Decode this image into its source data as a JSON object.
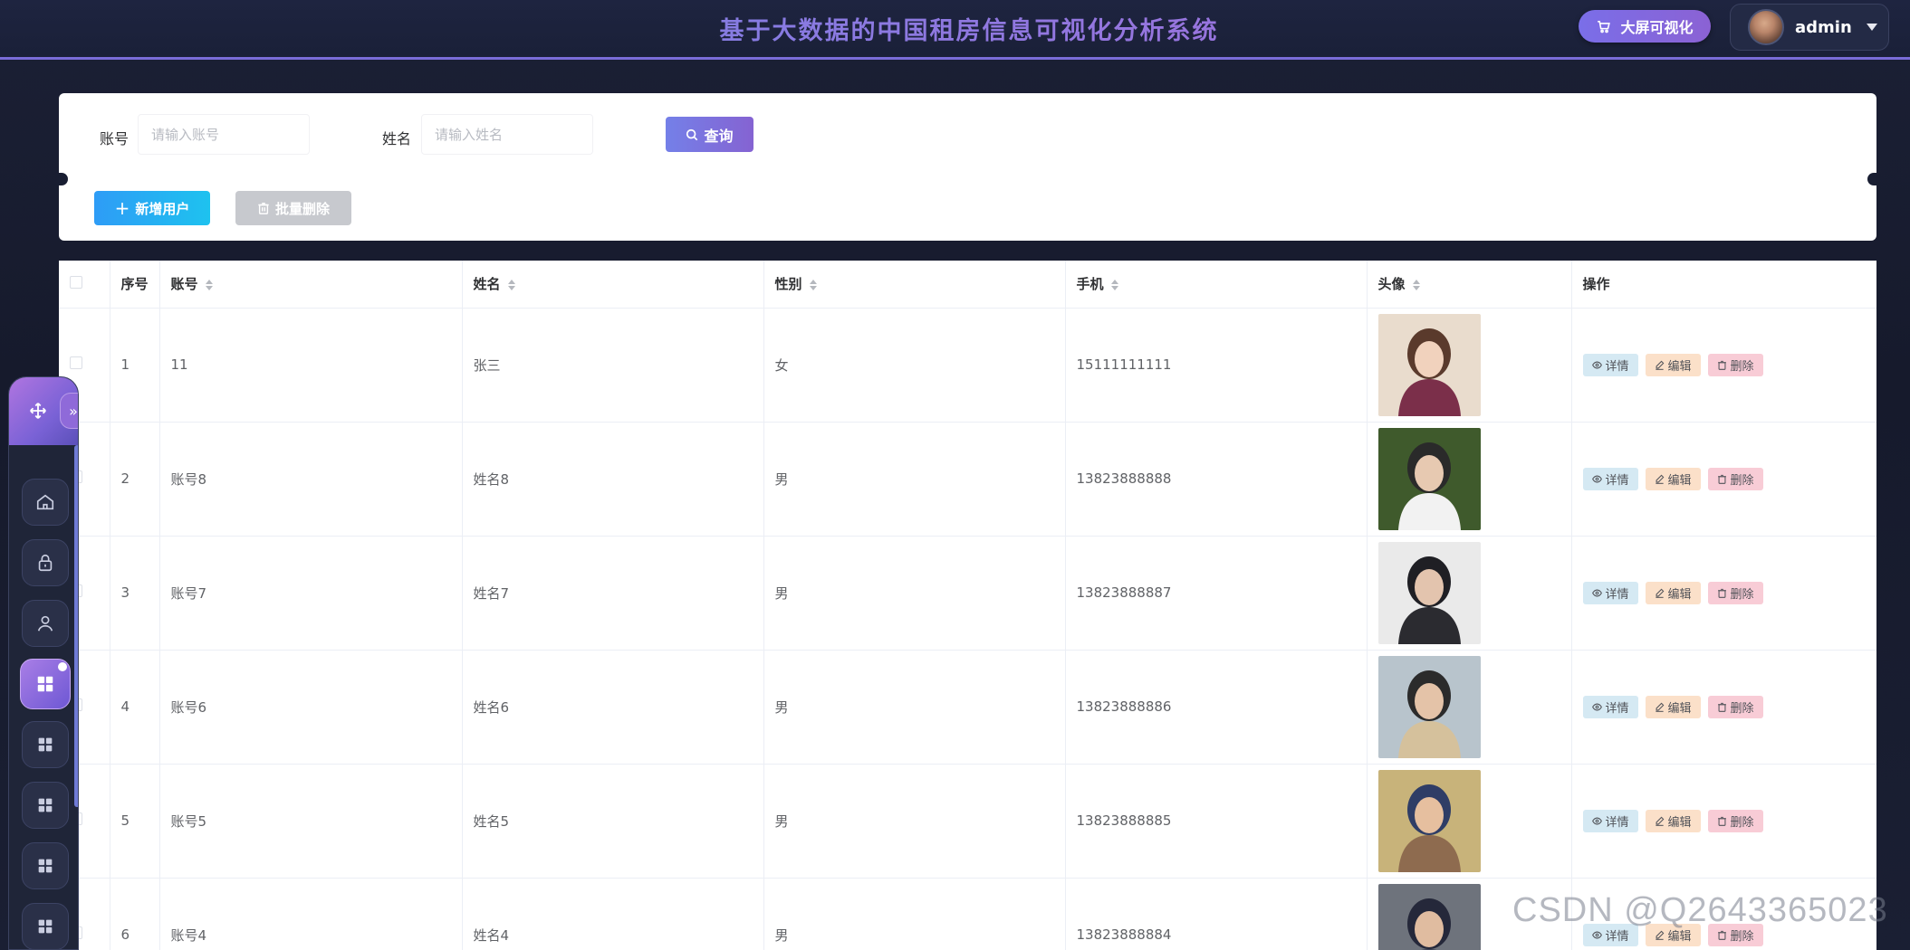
{
  "header": {
    "title": "基于大数据的中国租房信息可视化分析系统",
    "bigscreen_label": "大屏可视化",
    "user_name": "admin"
  },
  "search": {
    "account_label": "账号",
    "account_placeholder": "请输入账号",
    "name_label": "姓名",
    "name_placeholder": "请输入姓名",
    "query_label": "查询",
    "add_label": "新增用户",
    "batch_delete_label": "批量删除"
  },
  "table": {
    "columns": [
      "序号",
      "账号",
      "姓名",
      "性别",
      "手机",
      "头像",
      "操作"
    ],
    "op_labels": {
      "detail": "详情",
      "edit": "编辑",
      "delete": "删除"
    },
    "rows": [
      {
        "index": "1",
        "account": "11",
        "name": "张三",
        "gender": "女",
        "phone": "15111111111"
      },
      {
        "index": "2",
        "account": "账号8",
        "name": "姓名8",
        "gender": "男",
        "phone": "13823888888"
      },
      {
        "index": "3",
        "account": "账号7",
        "name": "姓名7",
        "gender": "男",
        "phone": "13823888887"
      },
      {
        "index": "4",
        "account": "账号6",
        "name": "姓名6",
        "gender": "男",
        "phone": "13823888886"
      },
      {
        "index": "5",
        "account": "账号5",
        "name": "姓名5",
        "gender": "男",
        "phone": "13823888885"
      },
      {
        "index": "6",
        "account": "账号4",
        "name": "姓名4",
        "gender": "男",
        "phone": "13823888884"
      }
    ]
  },
  "sidebar": {
    "items": [
      "home-icon",
      "lock-icon",
      "user-icon",
      "grid-icon",
      "grid-icon",
      "grid-icon",
      "grid-icon",
      "grid-icon"
    ]
  },
  "watermark": "CSDN @Q2643365023",
  "colors": {
    "accent_purple": "#7a62d6",
    "add_blue": "#2e9cf6",
    "detail_bg": "#d5e9f3",
    "edit_bg": "#fbe0c9",
    "delete_bg": "#f8ccd6"
  }
}
